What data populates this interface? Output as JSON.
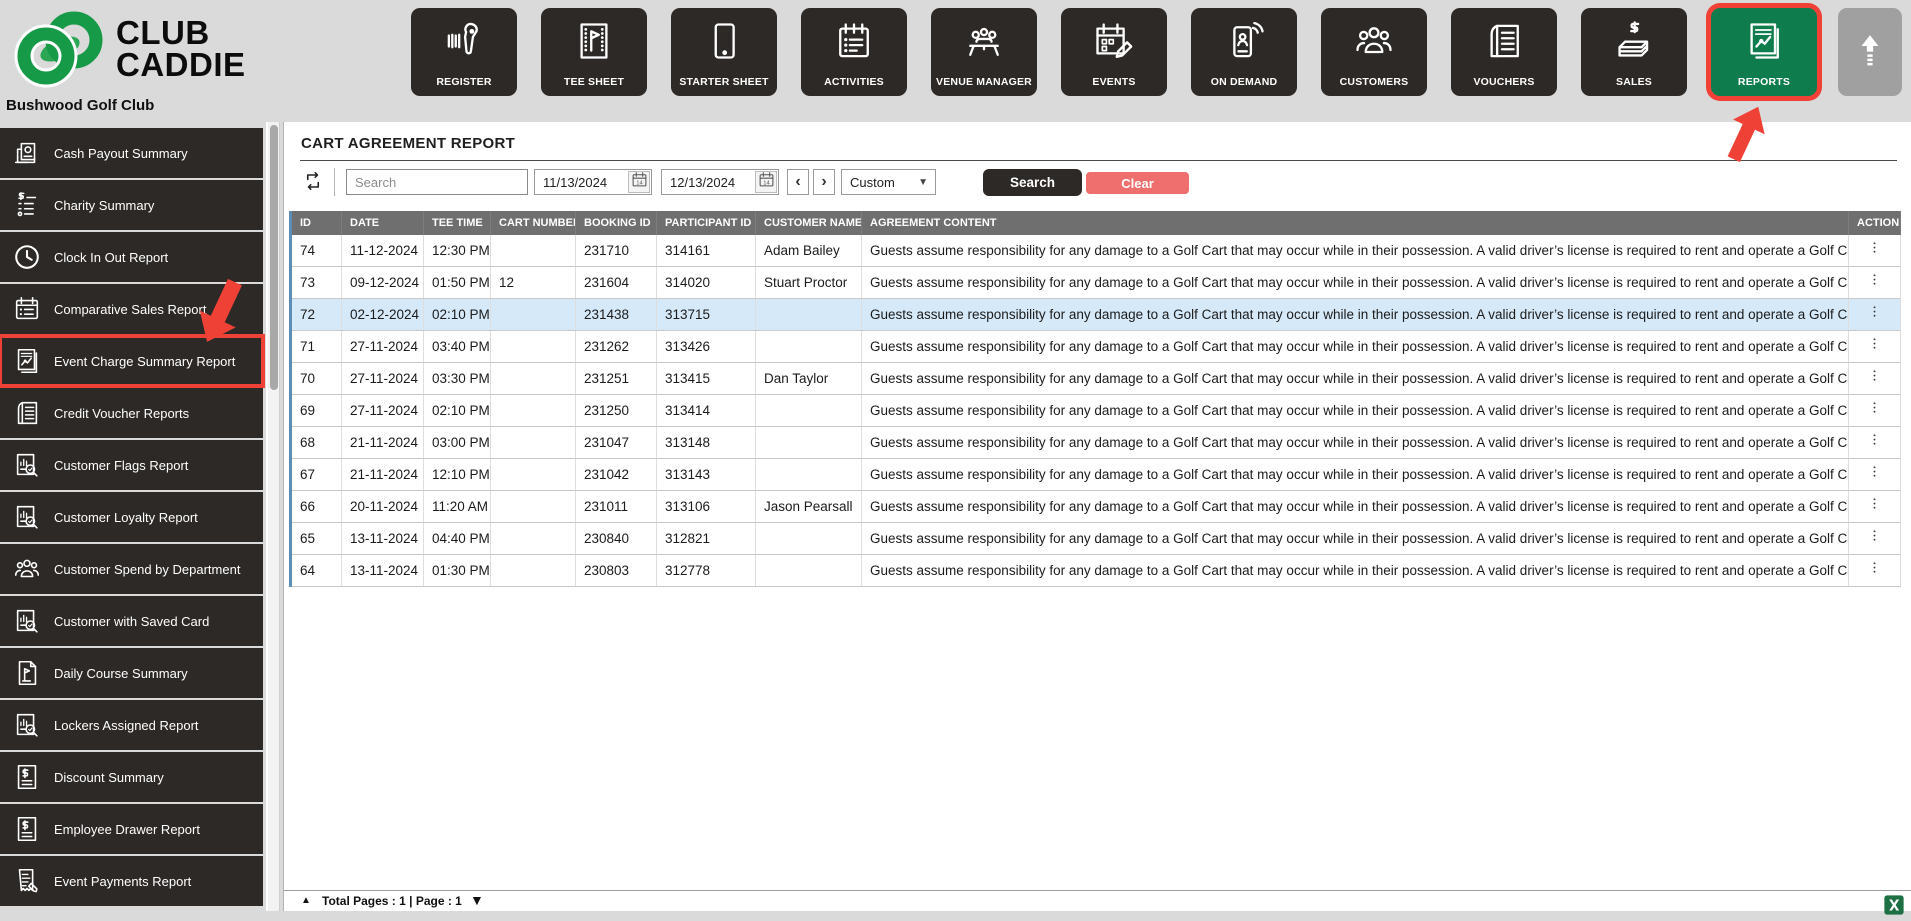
{
  "brand": {
    "logo_line1": "CLUB",
    "logo_line2": "CADDIE",
    "club_name": "Bushwood Golf Club"
  },
  "colors": {
    "brand_green": "#1b9a48",
    "active_nav_green": "#0e7c4c",
    "annotation_red": "#ef4136",
    "clear_button_red": "#ef6e6e",
    "dark_ui": "#2d2926",
    "table_header_gray": "#6f6f6f",
    "selected_row_blue": "#d6e9f8"
  },
  "top_nav": {
    "buttons": [
      {
        "label": "REGISTER",
        "icon": "barcode-scanner-icon"
      },
      {
        "label": "TEE SHEET",
        "icon": "tee-sheet-icon"
      },
      {
        "label": "STARTER SHEET",
        "icon": "tablet-icon"
      },
      {
        "label": "ACTIVITIES",
        "icon": "clipboard-list-icon"
      },
      {
        "label": "VENUE MANAGER",
        "icon": "meeting-table-icon"
      },
      {
        "label": "EVENTS",
        "icon": "calendar-pencil-icon"
      },
      {
        "label": "ON DEMAND",
        "icon": "phone-wireless-icon"
      },
      {
        "label": "CUSTOMERS",
        "icon": "people-group-icon"
      },
      {
        "label": "VOUCHERS",
        "icon": "voucher-icon"
      },
      {
        "label": "SALES",
        "icon": "money-icon"
      },
      {
        "label": "REPORTS",
        "icon": "report-chart-icon",
        "active": true,
        "annotated": true
      }
    ]
  },
  "sidebar": {
    "items": [
      {
        "label": "Cash Payout Summary",
        "icon": "cash-payout-icon"
      },
      {
        "label": "Charity Summary",
        "icon": "charity-icon"
      },
      {
        "label": "Clock In Out Report",
        "icon": "clock-icon"
      },
      {
        "label": "Comparative Sales Report",
        "icon": "calendar-list-icon"
      },
      {
        "label": "Event Charge Summary Report",
        "icon": "report-chart-icon",
        "highlighted": true
      },
      {
        "label": "Credit Voucher Reports",
        "icon": "voucher-icon"
      },
      {
        "label": "Customer Flags Report",
        "icon": "document-chart-magnifier-icon"
      },
      {
        "label": "Customer Loyalty Report",
        "icon": "document-chart-magnifier-icon"
      },
      {
        "label": "Customer Spend by Department",
        "icon": "people-group-icon"
      },
      {
        "label": "Customer with Saved Card",
        "icon": "document-chart-magnifier-icon"
      },
      {
        "label": "Daily Course Summary",
        "icon": "flag-document-icon"
      },
      {
        "label": "Lockers Assigned Report",
        "icon": "document-chart-magnifier-icon"
      },
      {
        "label": "Discount Summary",
        "icon": "dollar-document-icon"
      },
      {
        "label": "Employee Drawer Report",
        "icon": "dollar-document-icon"
      },
      {
        "label": "Event Payments Report",
        "icon": "receipt-icon"
      }
    ]
  },
  "report": {
    "title": "CART AGREEMENT REPORT",
    "toolbar": {
      "refresh_icon": "refresh-loop-icon",
      "search_placeholder": "Search",
      "date_from": "11/13/2024",
      "date_to": "12/13/2024",
      "prev_label": "‹",
      "next_label": "›",
      "range_selected": "Custom",
      "caret_glyph": "▼",
      "search_button": "Search",
      "clear_button": "Clear"
    },
    "table": {
      "columns": [
        "ID",
        "DATE",
        "TEE TIME",
        "CART NUMBER",
        "BOOKING ID",
        "PARTICIPANT ID",
        "CUSTOMER NAME",
        "AGREEMENT CONTENT",
        "ACTION"
      ],
      "agreement_content": "Guests assume responsibility for any damage to a Golf Cart that may occur while in their possession. A valid driver’s license is required to rent and operate a Golf Cart",
      "rows": [
        {
          "id": "74",
          "date": "11-12-2024",
          "tee_time": "12:30 PM",
          "cart_number": "",
          "booking_id": "231710",
          "participant_id": "314161",
          "customer_name": "Adam Bailey"
        },
        {
          "id": "73",
          "date": "09-12-2024",
          "tee_time": "01:50 PM",
          "cart_number": "12",
          "booking_id": "231604",
          "participant_id": "314020",
          "customer_name": "Stuart Proctor"
        },
        {
          "id": "72",
          "date": "02-12-2024",
          "tee_time": "02:10 PM",
          "cart_number": "",
          "booking_id": "231438",
          "participant_id": "313715",
          "customer_name": "",
          "selected": true
        },
        {
          "id": "71",
          "date": "27-11-2024",
          "tee_time": "03:40 PM",
          "cart_number": "",
          "booking_id": "231262",
          "participant_id": "313426",
          "customer_name": ""
        },
        {
          "id": "70",
          "date": "27-11-2024",
          "tee_time": "03:30 PM",
          "cart_number": "",
          "booking_id": "231251",
          "participant_id": "313415",
          "customer_name": "Dan Taylor"
        },
        {
          "id": "69",
          "date": "27-11-2024",
          "tee_time": "02:10 PM",
          "cart_number": "",
          "booking_id": "231250",
          "participant_id": "313414",
          "customer_name": ""
        },
        {
          "id": "68",
          "date": "21-11-2024",
          "tee_time": "03:00 PM",
          "cart_number": "",
          "booking_id": "231047",
          "participant_id": "313148",
          "customer_name": ""
        },
        {
          "id": "67",
          "date": "21-11-2024",
          "tee_time": "12:10 PM",
          "cart_number": "",
          "booking_id": "231042",
          "participant_id": "313143",
          "customer_name": ""
        },
        {
          "id": "66",
          "date": "20-11-2024",
          "tee_time": "11:20 AM",
          "cart_number": "",
          "booking_id": "231011",
          "participant_id": "313106",
          "customer_name": "Jason Pearsall"
        },
        {
          "id": "65",
          "date": "13-11-2024",
          "tee_time": "04:40 PM",
          "cart_number": "",
          "booking_id": "230840",
          "participant_id": "312821",
          "customer_name": ""
        },
        {
          "id": "64",
          "date": "13-11-2024",
          "tee_time": "01:30 PM",
          "cart_number": "",
          "booking_id": "230803",
          "participant_id": "312778",
          "customer_name": ""
        }
      ],
      "action_icon": "kebab-menu-icon"
    },
    "footer": {
      "collapse_glyph": "▲",
      "summary": "Total Pages : 1 | Page : 1",
      "expand_glyph": "▼",
      "export_icon": "excel-export-icon"
    }
  }
}
